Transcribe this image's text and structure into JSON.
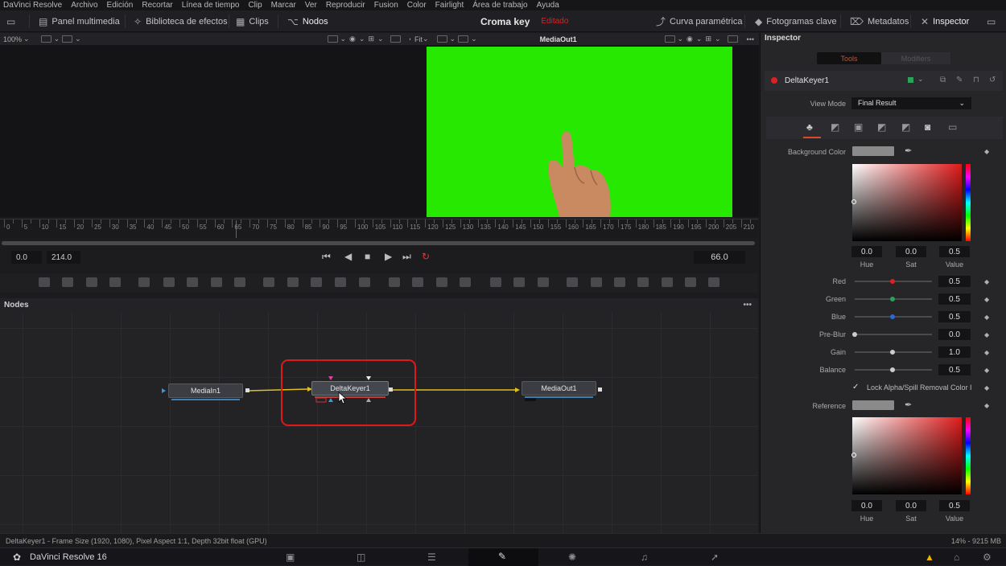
{
  "menu": [
    "DaVinci Resolve",
    "Archivo",
    "Edición",
    "Recortar",
    "Línea de tiempo",
    "Clip",
    "Marcar",
    "Ver",
    "Reproducir",
    "Fusion",
    "Color",
    "Fairlight",
    "Área de trabajo",
    "Ayuda"
  ],
  "toolbar": {
    "media_pool": "Panel multimedia",
    "effects_library": "Biblioteca de efectos",
    "clips": "Clips",
    "nodes": "Nodos",
    "project_title": "Croma key",
    "edited": "Editado",
    "curves": "Curva paramétrica",
    "keyframes": "Fotogramas clave",
    "metadata": "Metadatos",
    "inspector": "Inspector"
  },
  "viewer": {
    "zoom": "100%",
    "fit": "Fit",
    "right_label": "MediaOut1"
  },
  "timeline": {
    "ticks": [
      "0",
      "5",
      "10",
      "15",
      "20",
      "25",
      "30",
      "35",
      "40",
      "45",
      "50",
      "55",
      "60",
      "65",
      "70",
      "75",
      "80",
      "85",
      "90",
      "95",
      "100",
      "105",
      "110",
      "115",
      "120",
      "125",
      "130",
      "135",
      "140",
      "145",
      "150",
      "155",
      "160",
      "165",
      "170",
      "175",
      "180",
      "185",
      "190",
      "195",
      "200",
      "205",
      "210"
    ],
    "start": "0.0",
    "end": "214.0",
    "current": "66.0",
    "playhead_frame": 66,
    "range_end": 214
  },
  "nodes_panel": {
    "title": "Nodes",
    "node_in": "MediaIn1",
    "node_key": "DeltaKeyer1",
    "node_out": "MediaOut1"
  },
  "status": {
    "info": "DeltaKeyer1 - Frame Size (1920, 1080), Pixel Aspect 1:1, Depth 32bit float (GPU)",
    "memory": "14% - 9215 MB"
  },
  "app": {
    "name": "DaVinci Resolve 16"
  },
  "inspector": {
    "title": "Inspector",
    "tab_tools": "Tools",
    "tab_modifiers": "Modifiers",
    "tool_name": "DeltaKeyer1",
    "view_mode_label": "View Mode",
    "view_mode_value": "Final Result",
    "background_color_label": "Background Color",
    "hue_label": "Hue",
    "sat_label": "Sat",
    "value_label": "Value",
    "bg_hue": "0.0",
    "bg_sat": "0.0",
    "bg_value": "0.5",
    "red_label": "Red",
    "red": "0.5",
    "green_label": "Green",
    "green": "0.5",
    "blue_label": "Blue",
    "blue": "0.5",
    "preblur_label": "Pre-Blur",
    "preblur": "0.0",
    "gain_label": "Gain",
    "gain": "1.0",
    "balance_label": "Balance",
    "balance": "0.5",
    "lock_label": "Lock Alpha/Spill Removal Color I",
    "reference_label": "Reference",
    "ref_hue": "0.0",
    "ref_sat": "0.0",
    "ref_value": "0.5"
  },
  "colors": {
    "keyed_green": "#27e800",
    "accent_red": "#e01818",
    "node_line": "#e0c020"
  }
}
